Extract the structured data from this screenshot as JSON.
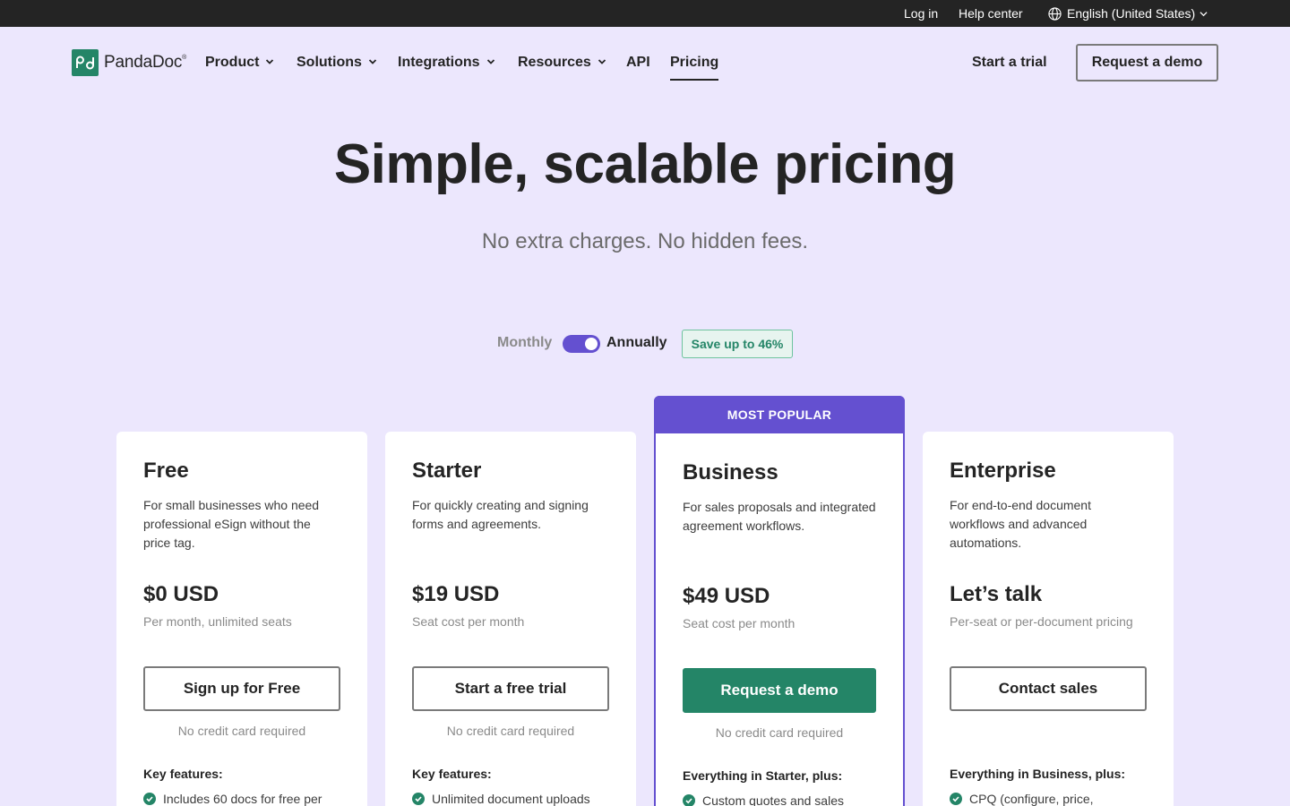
{
  "topbar": {
    "login": "Log in",
    "help": "Help center",
    "language": "English (United States)"
  },
  "nav": {
    "logo_text": "PandaDoc",
    "items": [
      {
        "label": "Product",
        "dropdown": true
      },
      {
        "label": "Solutions",
        "dropdown": true
      },
      {
        "label": "Integrations",
        "dropdown": true
      },
      {
        "label": "Resources",
        "dropdown": true
      },
      {
        "label": "API",
        "dropdown": false
      },
      {
        "label": "Pricing",
        "dropdown": false,
        "active": true
      }
    ],
    "start_trial": "Start a trial",
    "request_demo": "Request a demo"
  },
  "hero": {
    "title": "Simple, scalable pricing",
    "subtitle": "No extra charges. No hidden fees."
  },
  "billing": {
    "monthly": "Monthly",
    "annually": "Annually",
    "selected": "Annually",
    "save_badge": "Save up to 46%"
  },
  "plans": [
    {
      "name": "Free",
      "description": "For small businesses who need professional eSign without the price tag.",
      "price": "$0 USD",
      "price_note": "Per month, unlimited seats",
      "button": "Sign up for Free",
      "note": "No credit card required",
      "features_heading": "Key features:",
      "first_feature": "Includes 60 docs for free per"
    },
    {
      "name": "Starter",
      "description": "For quickly creating and signing forms and agreements.",
      "price": "$19 USD",
      "price_note": "Seat cost per month",
      "button": "Start a free trial",
      "note": "No credit card required",
      "features_heading": "Key features:",
      "first_feature": "Unlimited document uploads"
    },
    {
      "name": "Business",
      "badge": "MOST POPULAR",
      "description": "For sales proposals and integrated agreement workflows.",
      "price": "$49 USD",
      "price_note": "Seat cost per month",
      "button": "Request a demo",
      "note": "No credit card required",
      "features_heading": "Everything in Starter, plus:",
      "first_feature": "Custom quotes and sales"
    },
    {
      "name": "Enterprise",
      "description": "For end-to-end document workflows and advanced automations.",
      "price": "Let’s talk",
      "price_note": "Per-seat or per-document pricing",
      "button": "Contact sales",
      "note": "",
      "features_heading": "Everything in Business, plus:",
      "first_feature": "CPQ (configure, price,"
    }
  ],
  "colors": {
    "page_bg": "#ece7fd",
    "topbar_bg": "#242424",
    "brand_green": "#248567",
    "accent_purple": "#6450d0"
  }
}
